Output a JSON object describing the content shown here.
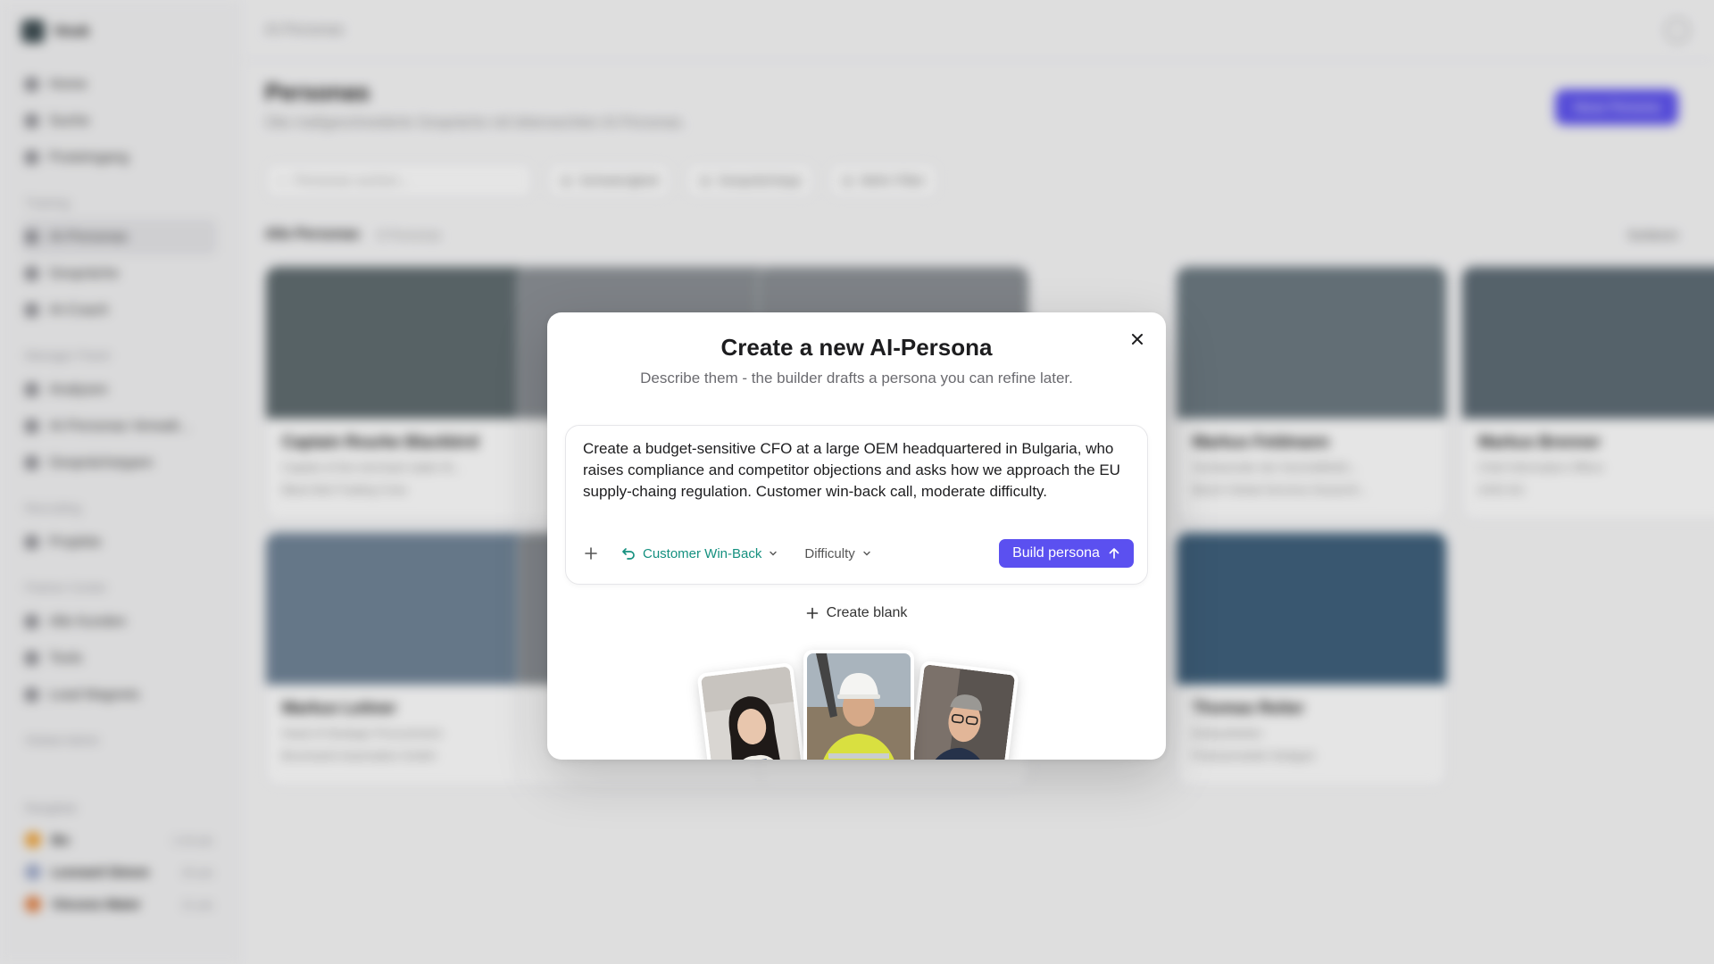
{
  "app": {
    "workspace": "Vouk",
    "breadcrumb": "AI-Personas",
    "nav": [
      "Home",
      "Suche",
      "Posteingang"
    ],
    "training_section": "Training",
    "training_items": [
      "AI-Personas",
      "Gespräche",
      "AI-Coach"
    ],
    "manager_section": "Manager Panel",
    "manager_items": [
      "Analysen",
      "AI-Personas Verwalt...",
      "Gesprächstypen"
    ],
    "recruiting_section": "Recruiting",
    "recruiting_items": [
      "Projekte"
    ],
    "partner_section": "Partner Center",
    "partner_items": [
      "Alle Kunden",
      "Tools",
      "Lead Magnets"
    ],
    "global_admin": "Global Admin",
    "recent_section": "Rangliste",
    "recent_users": [
      {
        "name": "Bo",
        "time": "1:24 pts",
        "color": "#f0a030"
      },
      {
        "name": "Leonard Simon",
        "time": "25 pts",
        "color": "#9aa6c8"
      },
      {
        "name": "Vincenz Maier",
        "time": "21 pts",
        "color": "#e07a3a"
      }
    ],
    "page_title": "Personas",
    "page_subtitle": "Übe maßgeschneiderte Gespräche mit lebensechten AI-Personas.",
    "new_button": "Neue Persona",
    "search_placeholder": "Personas suchen...",
    "filter_chips": [
      "Schwierigkeit",
      "Gesprächstyp",
      "Mehr Filter"
    ],
    "list_title": "Alle Personas",
    "list_count": "8 Personas",
    "sort_label": "Sortieren",
    "cards": [
      {
        "name": "Captain Rourke Blackbird",
        "role": "Captain of the merchant raider M...",
        "company": "Black Bird Trading Crew"
      },
      {
        "name": "Markus Feldmann",
        "role": "Vorsitzender der Geschäftsfüh...",
        "company": "Bosch Global Services Deutschl..."
      },
      {
        "name": "Markus Brenner",
        "role": "Chief Information Officer",
        "company": "AXEI AG"
      },
      {
        "name": "Markus Leitner",
        "role": "Head of Strategic Procurement",
        "company": "Brunnwerk Automation GmbH"
      },
      {
        "name": "Thomas Reiter",
        "role": "Einkaufsleiter",
        "company": "Präzisionsteile Stuttgart"
      }
    ]
  },
  "modal": {
    "title": "Create a new AI-Persona",
    "subtitle": "Describe them - the builder drafts a persona you can refine later.",
    "prompt": "Create a budget-sensitive CFO at a large OEM headquartered in Bulgaria, who raises compliance and competitor objections and asks how we approach the EU supply-chaing regulation. Customer win-back call, moderate difficulty.",
    "mode_label": "Customer Win-Back",
    "difficulty_label": "Difficulty",
    "build_label": "Build persona",
    "create_blank_label": "Create blank"
  },
  "icons": {
    "close": "close-icon",
    "add": "plus-icon",
    "mode": "undo-arrow-icon",
    "dropdown": "chevron-down-icon",
    "submit": "arrow-up-icon"
  },
  "colors": {
    "accent": "#5b50f0",
    "mode_teal": "#14907f"
  }
}
